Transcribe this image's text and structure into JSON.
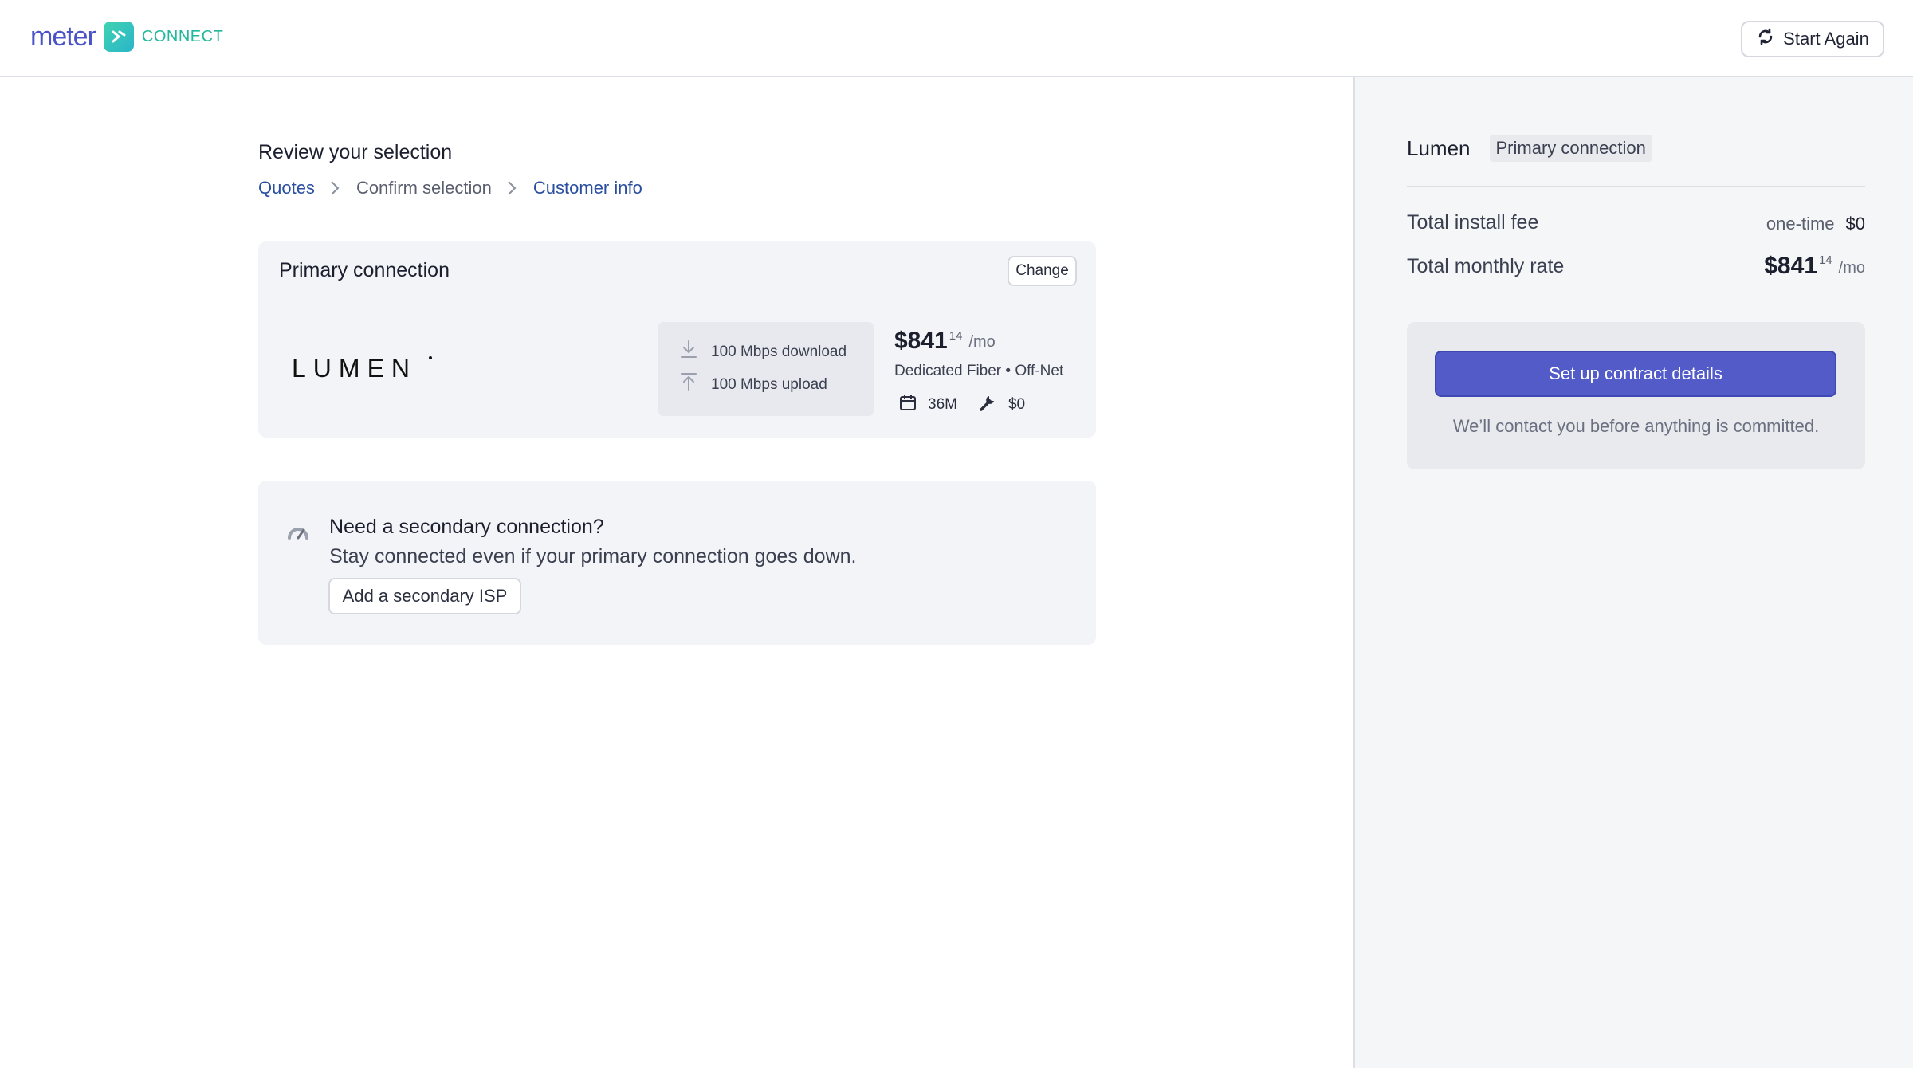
{
  "header": {
    "brand_name": "meter",
    "brand_product": "CONNECT",
    "start_again_label": "Start Again",
    "brand_color": "#4b54c7",
    "accent_color": "#22b89c"
  },
  "review": {
    "title": "Review your selection",
    "breadcrumb": [
      {
        "label": "Quotes",
        "active": true
      },
      {
        "label": "Confirm selection",
        "active": false
      },
      {
        "label": "Customer info",
        "active": true
      }
    ]
  },
  "primary": {
    "title": "Primary connection",
    "change_label": "Change",
    "provider_logo_text": "LUMEN",
    "download": "100 Mbps download",
    "upload": "100 Mbps upload",
    "price_dollars": "$841",
    "price_cents": "14",
    "price_period": "/mo",
    "service_type": "Dedicated Fiber • Off-Net",
    "term": "36M",
    "install_fee": "$0",
    "icons": [
      "download-icon",
      "upload-icon",
      "calendar-icon",
      "wrench-icon"
    ]
  },
  "secondary": {
    "title": "Need a secondary connection?",
    "description": "Stay connected even if your primary connection goes down.",
    "button_label": "Add a secondary ISP",
    "icon": "gauge-icon"
  },
  "summary": {
    "provider": "Lumen",
    "badge": "Primary connection",
    "install_label": "Total install fee",
    "install_qualifier": "one-time",
    "install_value": "$0",
    "monthly_label": "Total monthly rate",
    "monthly_dollars": "$841",
    "monthly_cents": "14",
    "monthly_period": "/mo",
    "cta_label": "Set up contract details",
    "cta_note": "We’ll contact you before anything is committed.",
    "cta_color": "#525bc7"
  }
}
